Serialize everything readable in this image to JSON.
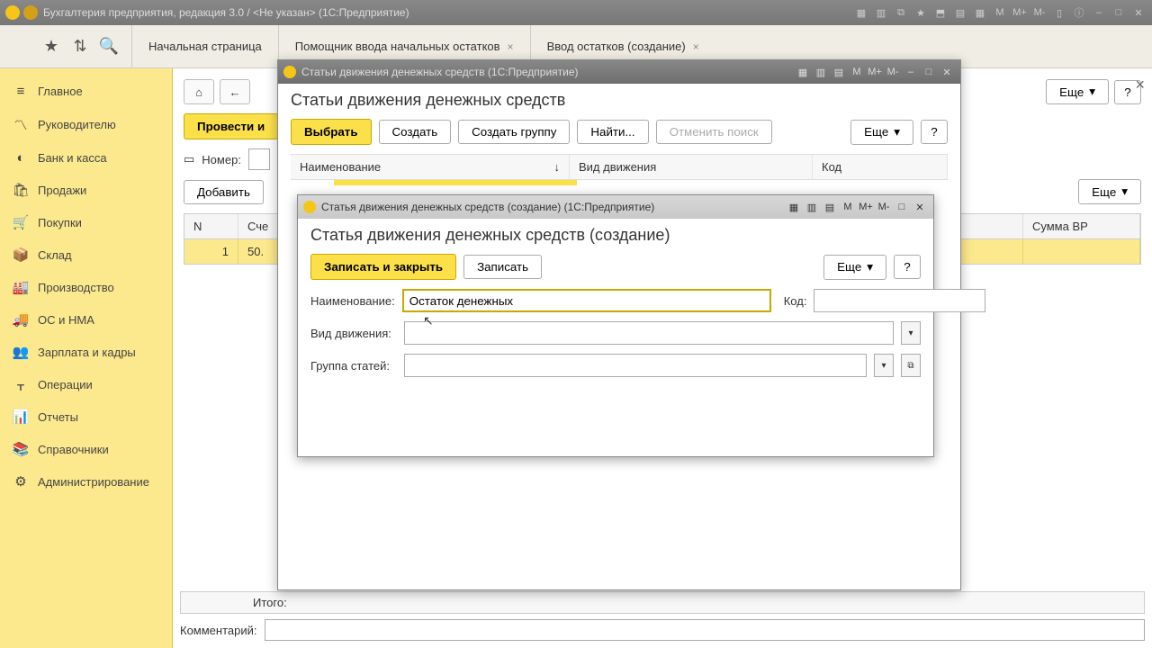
{
  "titlebar": {
    "text": "Бухгалтерия предприятия, редакция 3.0 / <Не указан> (1С:Предприятие)"
  },
  "topicons": {
    "star": "★",
    "link": "⇅",
    "search": "🔍"
  },
  "tabs": [
    {
      "label": "Начальная страница"
    },
    {
      "label": "Помощник ввода начальных остатков"
    },
    {
      "label": "Ввод остатков (создание)"
    }
  ],
  "sidebar": [
    {
      "icon": "≡",
      "label": "Главное"
    },
    {
      "icon": "〽",
      "label": "Руководителю"
    },
    {
      "icon": "◐",
      "label": "Банк и касса"
    },
    {
      "icon": "🛍",
      "label": "Продажи"
    },
    {
      "icon": "🛒",
      "label": "Покупки"
    },
    {
      "icon": "📦",
      "label": "Склад"
    },
    {
      "icon": "🏭",
      "label": "Производство"
    },
    {
      "icon": "🚚",
      "label": "ОС и НМА"
    },
    {
      "icon": "👥",
      "label": "Зарплата и кадры"
    },
    {
      "icon": "ᚁ",
      "label": "Операции"
    },
    {
      "icon": "📊",
      "label": "Отчеты"
    },
    {
      "icon": "📚",
      "label": "Справочники"
    },
    {
      "icon": "⚙",
      "label": "Администрирование"
    }
  ],
  "content": {
    "home": "⌂",
    "back": "←",
    "process_btn": "Провести и",
    "number_label": "Номер:",
    "add_btn": "Добавить",
    "more": "Еще",
    "help": "?",
    "cols": {
      "n": "N",
      "acc": "Сче",
      "vbr": "Сумма ВР"
    },
    "row": {
      "n": "1",
      "acc": "50."
    },
    "total": "Итого:",
    "comment": "Комментарий:"
  },
  "modal1": {
    "titlebar": "Статьи движения денежных средств   (1С:Предприятие)",
    "title": "Статьи движения денежных средств",
    "select": "Выбрать",
    "create": "Создать",
    "create_group": "Создать группу",
    "find": "Найти...",
    "cancel_search": "Отменить поиск",
    "more": "Еще",
    "help": "?",
    "cols": {
      "name": "Наименование",
      "sort": "↓",
      "type": "Вид движения",
      "code": "Код"
    }
  },
  "modal2": {
    "titlebar": "Статья движения денежных средств (создание)   (1С:Предприятие)",
    "title": "Статья движения денежных средств (создание)",
    "save_close": "Записать и закрыть",
    "save": "Записать",
    "more": "Еще",
    "help": "?",
    "name_label": "Наименование:",
    "name_value": "Остаток денежных",
    "code_label": "Код:",
    "type_label": "Вид движения:",
    "group_label": "Группа статей:"
  },
  "sysicons": {
    "m": "M",
    "mp": "M+",
    "mm": "M-",
    "min": "–",
    "max": "□",
    "close": "✕"
  }
}
